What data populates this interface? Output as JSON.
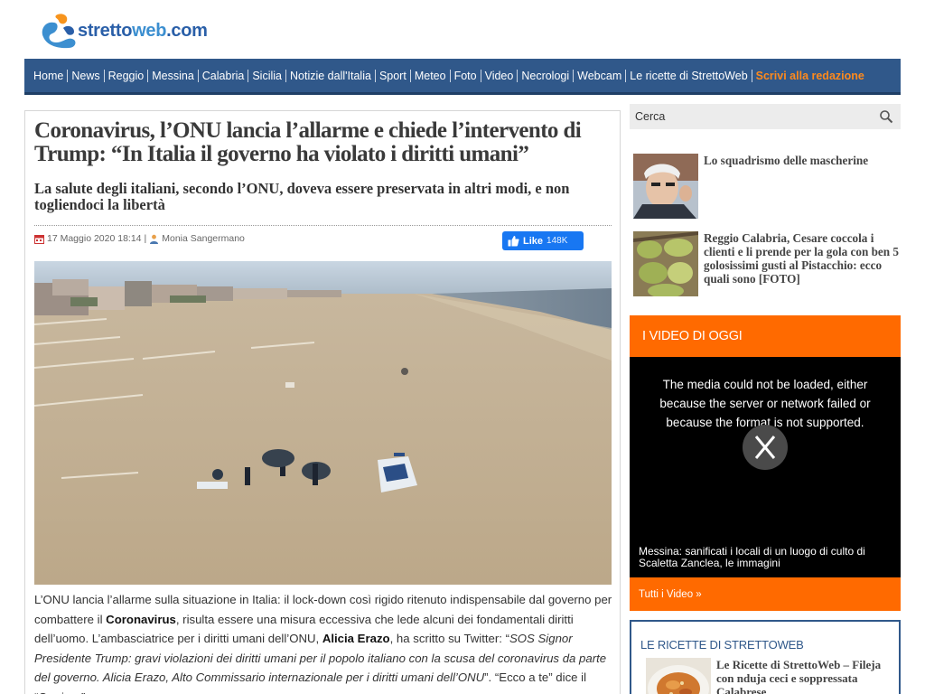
{
  "header": {
    "logo_text_main": "stretto",
    "logo_text_accent": "web",
    "logo_text_suffix": ".com"
  },
  "nav": {
    "items": [
      {
        "label": "Home"
      },
      {
        "label": "News"
      },
      {
        "label": "Reggio"
      },
      {
        "label": "Messina"
      },
      {
        "label": "Calabria"
      },
      {
        "label": "Sicilia"
      },
      {
        "label": "Notizie dall'Italia"
      },
      {
        "label": "Sport"
      },
      {
        "label": "Meteo"
      },
      {
        "label": "Foto"
      },
      {
        "label": "Video"
      },
      {
        "label": "Necrologi"
      },
      {
        "label": "Webcam"
      },
      {
        "label": "Le ricette di StrettoWeb"
      }
    ],
    "highlight": "Scrivi alla redazione"
  },
  "article": {
    "headline": "Coronavirus, l’ONU lancia l’allarme e chiede l’intervento di Trump: “In Italia il governo ha violato i diritti umani”",
    "subtitle": "La salute degli italiani, secondo l’ONU, doveva essere preservata in altri modi, e non togliendoci la libertà",
    "date": "17 Maggio 2020 18:14",
    "author": "Monia Sangermano",
    "like_label": "Like",
    "like_count": "148K",
    "body": {
      "p1_a": "L’ONU lancia l’allarme sulla situazione in Italia: il lock-down così rigido ritenuto indispensabile dal governo per combattere il ",
      "p1_b": "Coronavirus",
      "p1_c": ", risulta essere una misura eccessiva che lede alcuni dei fondamentali diritti dell’uomo. L’ambasciatrice per i diritti umani dell’ONU, ",
      "p1_d": "Alicia Erazo",
      "p1_e": ", ha scritto su Twitter: “",
      "p1_f": "SOS Signor Presidente Trump: gravi violazioni dei diritti umani per il popolo italiano con la scusa del coronavirus da parte del governo. Alicia Erazo, Alto Commissario internazionale per i diritti umani dell’ONU",
      "p1_g": "”. “Ecco a te” dice il “Corriere”."
    }
  },
  "sidebar": {
    "search_placeholder": "Cerca",
    "news": [
      {
        "title": "Lo squadrismo delle mascherine"
      },
      {
        "title": "Reggio Calabria, Cesare coccola i clienti e li prende per la gola con ben 5 golosissimi gusti al Pistacchio: ecco quali sono [FOTO]"
      }
    ],
    "videos": {
      "header": "I VIDEO DI OGGI",
      "error": "The media could not be loaded, either because the server or network failed or because the format is not supported.",
      "caption": "Messina: sanificati i locali di un luogo di culto di Scaletta Zanclea, le immagini",
      "footer_link": "Tutti i Video »"
    },
    "recipes": {
      "header": "LE RICETTE DI STRETTOWEB",
      "item_title": "Le Ricette di StrettoWeb – Fileja con nduja ceci e soppressata Calabrese"
    }
  },
  "colors": {
    "nav_bg": "#30588a",
    "accent_orange": "#ff6a00",
    "facebook_blue": "#1877f2"
  },
  "icons": [
    "logo-icon",
    "calendar-icon",
    "user-icon",
    "thumbs-up-icon",
    "search-icon",
    "close-icon"
  ]
}
